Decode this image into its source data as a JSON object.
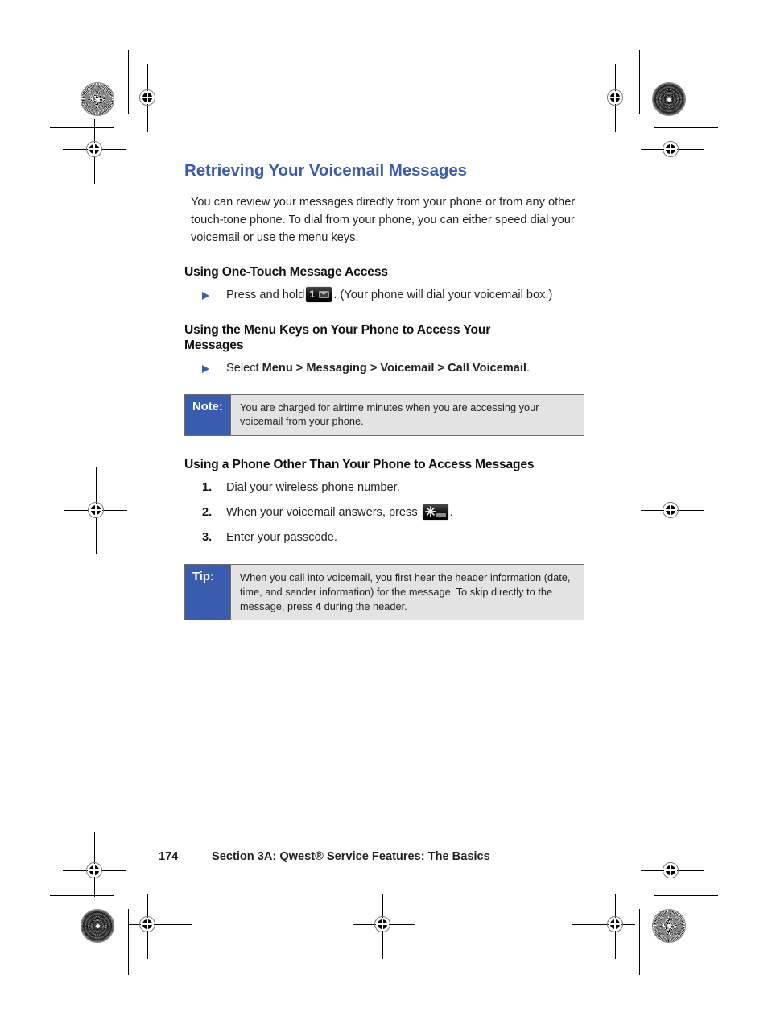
{
  "page": {
    "title": "Retrieving Your Voicemail Messages",
    "intro": "You can review your messages directly from your phone or from any other touch-tone phone. To dial from your phone, you can either speed dial your voicemail or use the menu keys.",
    "accent_color": "#3a5cae",
    "text_color": "#231f20"
  },
  "sections": [
    {
      "heading": "Using One-Touch Message Access",
      "bullet_prefix": "Press and hold",
      "bullet_key": "voicemail-key-1",
      "bullet_suffix": ". (Your phone will dial your voicemail box.)"
    },
    {
      "heading": "Using the Menu Keys on Your Phone to Access Your Messages",
      "bullet_prefix": "Select ",
      "bullet_path": "Menu > Messaging > Voicemail > Call Voicemail",
      "bullet_suffix": "."
    },
    {
      "heading": "Using a Phone Other Than Your Phone to Access Messages"
    }
  ],
  "note": {
    "label": "Note:",
    "text": "You are charged for airtime minutes when you are accessing your voicemail from your phone.",
    "label_bg": "#3a5cae",
    "body_bg": "#e3e3e3"
  },
  "steps": [
    {
      "num": "1.",
      "pre": "Dial your wireless phone number.",
      "post": ""
    },
    {
      "num": "2.",
      "pre": "When your voicemail answers, press ",
      "key": "star-key",
      "post": "."
    },
    {
      "num": "3.",
      "pre": "Enter your passcode.",
      "post": ""
    }
  ],
  "tip": {
    "label": "Tip:",
    "text_part1": "When you call into voicemail, you first hear the header information (date, time, and sender information) for the message. To skip directly to the message, press ",
    "emphasis": "4",
    "text_part2": " during the header.",
    "label_bg": "#3a5cae",
    "body_bg": "#e3e3e3"
  },
  "footer": {
    "page_number": "174",
    "section_label": "Section 3A: Qwest® Service Features: The Basics"
  },
  "keys": {
    "voicemail_key_digit": "1",
    "star_key_glyph": "✳"
  }
}
